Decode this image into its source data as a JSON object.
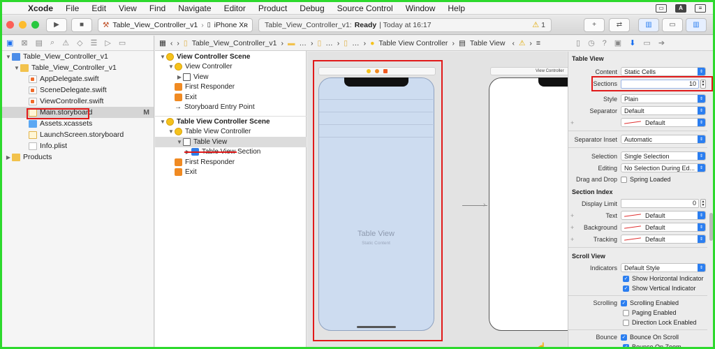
{
  "menubar": {
    "app": "Xcode",
    "items": [
      "File",
      "Edit",
      "View",
      "Find",
      "Navigate",
      "Editor",
      "Product",
      "Debug",
      "Source Control",
      "Window",
      "Help"
    ],
    "right_icon_letter": "A"
  },
  "toolbar": {
    "scheme": "Table_View_Controller_v1",
    "device": "iPhone Xʀ",
    "status_project": "Table_View_Controller_v1:",
    "status_ready": "Ready",
    "status_time": "| Today at 16:17",
    "warning_count": "1",
    "add_label": "+",
    "swap_label": "⇄"
  },
  "navigator": {
    "rows": [
      {
        "label": "Table_View_Controller_v1",
        "indent": 0,
        "icon": "proj",
        "disclosure": "▼"
      },
      {
        "label": "Table_View_Controller_v1",
        "indent": 1,
        "icon": "folder",
        "disclosure": "▼"
      },
      {
        "label": "AppDelegate.swift",
        "indent": 2,
        "icon": "swift",
        "disclosure": ""
      },
      {
        "label": "SceneDelegate.swift",
        "indent": 2,
        "icon": "swift",
        "disclosure": ""
      },
      {
        "label": "ViewController.swift",
        "indent": 2,
        "icon": "swift",
        "disclosure": ""
      },
      {
        "label": "Main.storyboard",
        "indent": 2,
        "icon": "sb",
        "disclosure": "",
        "badge": "M",
        "selected": true
      },
      {
        "label": "Assets.xcassets",
        "indent": 2,
        "icon": "assets",
        "disclosure": ""
      },
      {
        "label": "LaunchScreen.storyboard",
        "indent": 2,
        "icon": "sb",
        "disclosure": ""
      },
      {
        "label": "Info.plist",
        "indent": 2,
        "icon": "plist",
        "disclosure": ""
      },
      {
        "label": "Products",
        "indent": 0,
        "icon": "folder",
        "disclosure": "▶"
      }
    ]
  },
  "jumpbar": {
    "items": [
      "Table_View_Controller_v1",
      "…",
      "…",
      "…",
      "…",
      "Table View Controller",
      "Table View"
    ],
    "warning": "⚠"
  },
  "outline": {
    "rows": [
      {
        "label": "View Controller Scene",
        "indent": 0,
        "icon": "yellow",
        "disc": "▼",
        "scene": true
      },
      {
        "label": "View Controller",
        "indent": 1,
        "icon": "yellow",
        "disc": "▼"
      },
      {
        "label": "View",
        "indent": 2,
        "icon": "sq",
        "disc": "▶"
      },
      {
        "label": "First Responder",
        "indent": 1,
        "icon": "orange",
        "disc": ""
      },
      {
        "label": "Exit",
        "indent": 1,
        "icon": "orange",
        "disc": ""
      },
      {
        "label": "Storyboard Entry Point",
        "indent": 1,
        "icon": "arrow",
        "disc": ""
      },
      {
        "label": "",
        "indent": 0,
        "icon": "",
        "disc": "",
        "spacer": true
      },
      {
        "label": "Table View Controller Scene",
        "indent": 0,
        "icon": "yellow",
        "disc": "▼",
        "scene": true
      },
      {
        "label": "Table View Controller",
        "indent": 1,
        "icon": "yellow",
        "disc": "▼"
      },
      {
        "label": "Table View",
        "indent": 2,
        "icon": "tv",
        "disc": "▼",
        "selected": true
      },
      {
        "label": "Table View Section",
        "indent": 3,
        "icon": "blue",
        "disc": "▶"
      },
      {
        "label": "First Responder",
        "indent": 1,
        "icon": "orange",
        "disc": ""
      },
      {
        "label": "Exit",
        "indent": 1,
        "icon": "orange",
        "disc": ""
      }
    ]
  },
  "canvas": {
    "table_view_title": "Table View",
    "table_view_subtitle": "Static Content",
    "second_scene_title": "View Controller"
  },
  "inspector": {
    "section_title": "Table View",
    "content_label": "Content",
    "content_value": "Static Cells",
    "sections_label": "Sections",
    "sections_value": "10",
    "style_label": "Style",
    "style_value": "Plain",
    "separator_label": "Separator",
    "separator_value": "Default",
    "separator_color_value": "Default",
    "separator_inset_label": "Separator Inset",
    "separator_inset_value": "Automatic",
    "selection_label": "Selection",
    "selection_value": "Single Selection",
    "editing_label": "Editing",
    "editing_value": "No Selection During Ed...",
    "drag_drop_label": "Drag and Drop",
    "spring_loaded": "Spring Loaded",
    "section_index_title": "Section Index",
    "display_limit_label": "Display Limit",
    "display_limit_value": "0",
    "text_label": "Text",
    "text_value": "Default",
    "background_label": "Background",
    "background_value": "Default",
    "tracking_label": "Tracking",
    "tracking_value": "Default",
    "scroll_view_title": "Scroll View",
    "indicators_label": "Indicators",
    "indicators_value": "Default Style",
    "show_horizontal": "Show Horizontal Indicator",
    "show_vertical": "Show Vertical Indicator",
    "scrolling_label": "Scrolling",
    "scrolling_enabled": "Scrolling Enabled",
    "paging_enabled": "Paging Enabled",
    "direction_lock": "Direction Lock Enabled",
    "bounce_label": "Bounce",
    "bounce_on_scroll": "Bounce On Scroll",
    "bounce_on_zoom": "Bounce On Zoom"
  },
  "colors": {
    "accent": "#2b7ef0",
    "highlight": "#e11919",
    "screen_frame": "#2dd92d"
  }
}
